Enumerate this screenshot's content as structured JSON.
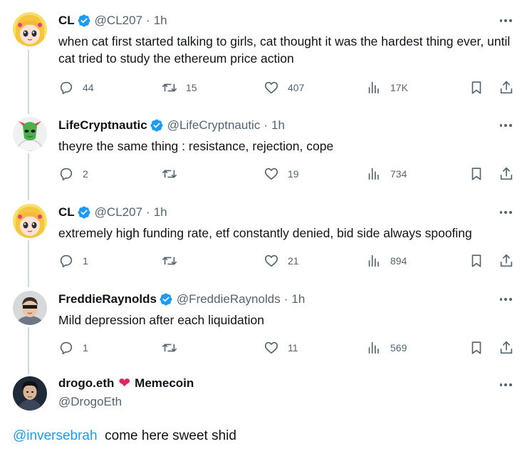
{
  "tweets": [
    {
      "name": "CL",
      "handle": "@CL207",
      "time": "1h",
      "text": "when cat first started talking to girls, cat thought it was the hardest thing ever, until cat tried to study the ethereum price action",
      "replies": "44",
      "retweets": "15",
      "likes": "407",
      "views": "17K",
      "avatar": "anime-girl-avatar"
    },
    {
      "name": "LifeCryptnautic",
      "handle": "@LifeCryptnautic",
      "time": "1h",
      "text": "theyre the same thing : resistance, rejection, cope",
      "replies": "2",
      "retweets": "",
      "likes": "19",
      "views": "734",
      "avatar": "green-alien-avatar"
    },
    {
      "name": "CL",
      "handle": "@CL207",
      "time": "1h",
      "text": "extremely high funding rate, etf constantly denied, bid side always spoofing",
      "replies": "1",
      "retweets": "",
      "likes": "21",
      "views": "894",
      "avatar": "anime-girl-avatar"
    },
    {
      "name": "FreddieRaynolds",
      "handle": "@FreddieRaynolds",
      "time": "1h",
      "text": "Mild depression after each liquidation",
      "replies": "1",
      "retweets": "",
      "likes": "11",
      "views": "569",
      "avatar": "man-avatar"
    }
  ],
  "main_tweet": {
    "name_part1": "drogo.eth",
    "emoji": "❤",
    "name_part2": "Memecoin",
    "handle": "@DrogoEth",
    "mention": "@inversebrah",
    "text": "come here sweet shid"
  },
  "separator": "·",
  "colors": {
    "accent": "#1d9bf0",
    "muted": "#536471",
    "thread_line": "#cfd9de",
    "heart": "#e0245e"
  }
}
